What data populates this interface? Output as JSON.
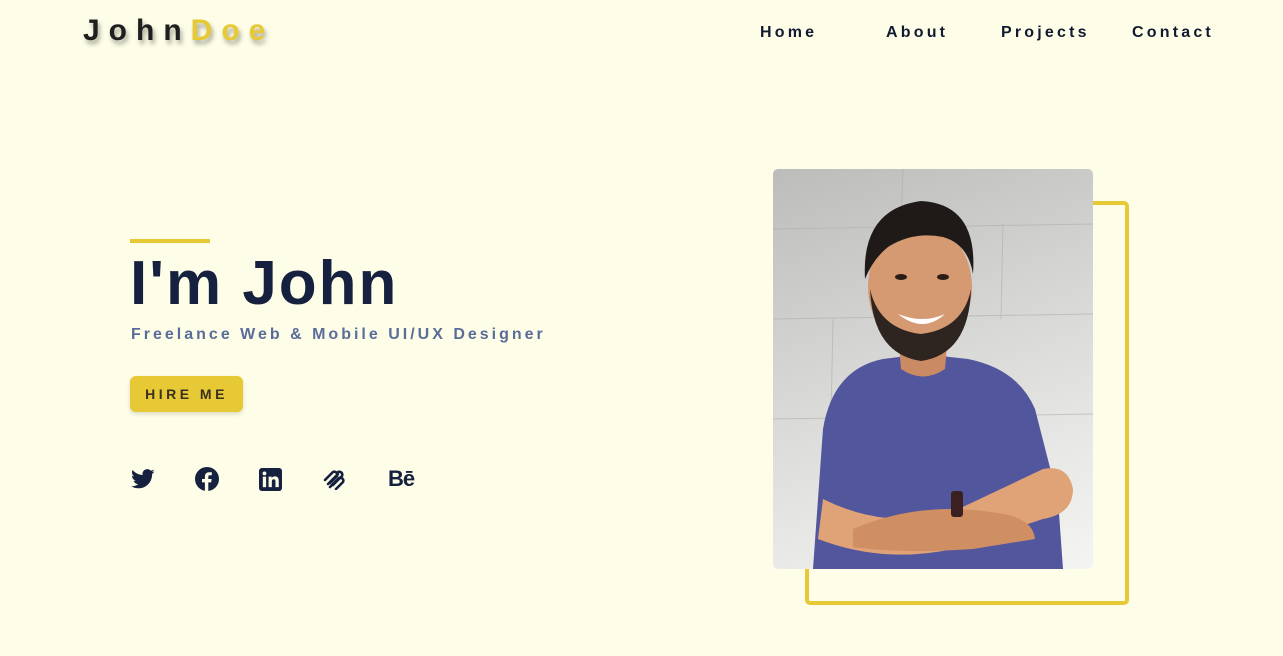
{
  "header": {
    "logo_first": "John",
    "logo_last": "Doe",
    "nav": {
      "home": "Home",
      "about": "About",
      "projects": "Projects",
      "contact": "Contact"
    }
  },
  "hero": {
    "title": "I'm John",
    "subtitle": "Freelance Web & Mobile UI/UX Designer",
    "cta_label": "HIRE ME",
    "socials": {
      "twitter": "twitter-icon",
      "facebook": "facebook-icon",
      "linkedin": "linkedin-icon",
      "squarespace": "squarespace-icon",
      "behance_label": "Bē"
    }
  },
  "portrait": {
    "image": "portrait-photo"
  },
  "colors": {
    "background": "#fefee8",
    "accent": "#e6c934",
    "navy": "#15213f",
    "subtitle": "#5a6d9a"
  }
}
